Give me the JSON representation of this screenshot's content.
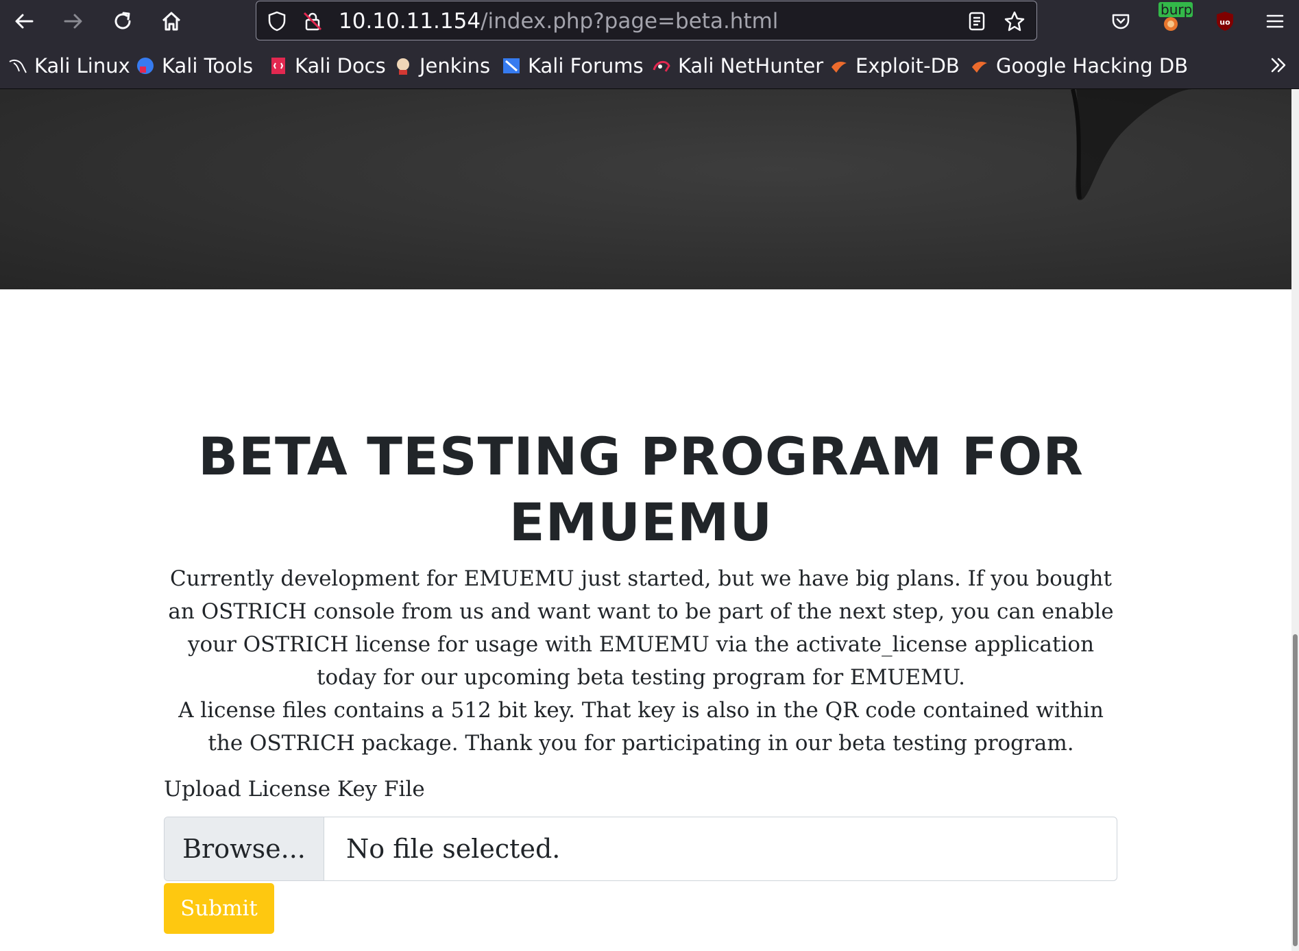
{
  "browser": {
    "url_host": "10.10.11.154",
    "url_path": "/index.php?page=beta.html",
    "extension_badge": "burp",
    "bookmarks": [
      {
        "label": "Kali Linux",
        "icon": "kali-dragon-icon"
      },
      {
        "label": "Kali Tools",
        "icon": "kali-tools-icon"
      },
      {
        "label": "Kali Docs",
        "icon": "kali-docs-icon"
      },
      {
        "label": "Jenkins",
        "icon": "jenkins-icon"
      },
      {
        "label": "Kali Forums",
        "icon": "kali-forums-icon"
      },
      {
        "label": "Kali NetHunter",
        "icon": "nethunter-icon"
      },
      {
        "label": "Exploit-DB",
        "icon": "exploit-db-icon"
      },
      {
        "label": "Google Hacking DB",
        "icon": "ghdb-icon"
      }
    ]
  },
  "page": {
    "heading": "BETA TESTING PROGRAM FOR EMUEMU",
    "paragraph_1": "Currently development for EMUEMU just started, but we have big plans. If you bought an OSTRICH console from us and want want to be part of the next step, you can enable your OSTRICH license for usage with EMUEMU via the activate_license application today for our upcoming beta testing program for EMUEMU.",
    "paragraph_2": "A license files contains a 512 bit key. That key is also in the QR code contained within the OSTRICH package. Thank you for participating in our beta testing program.",
    "upload_label": "Upload License Key File",
    "browse_label": "Browse...",
    "file_status": "No file selected.",
    "submit_label": "Submit"
  },
  "colors": {
    "toolbar_bg": "#2b2a33",
    "submit_bg": "#fec810",
    "text": "#212529"
  }
}
